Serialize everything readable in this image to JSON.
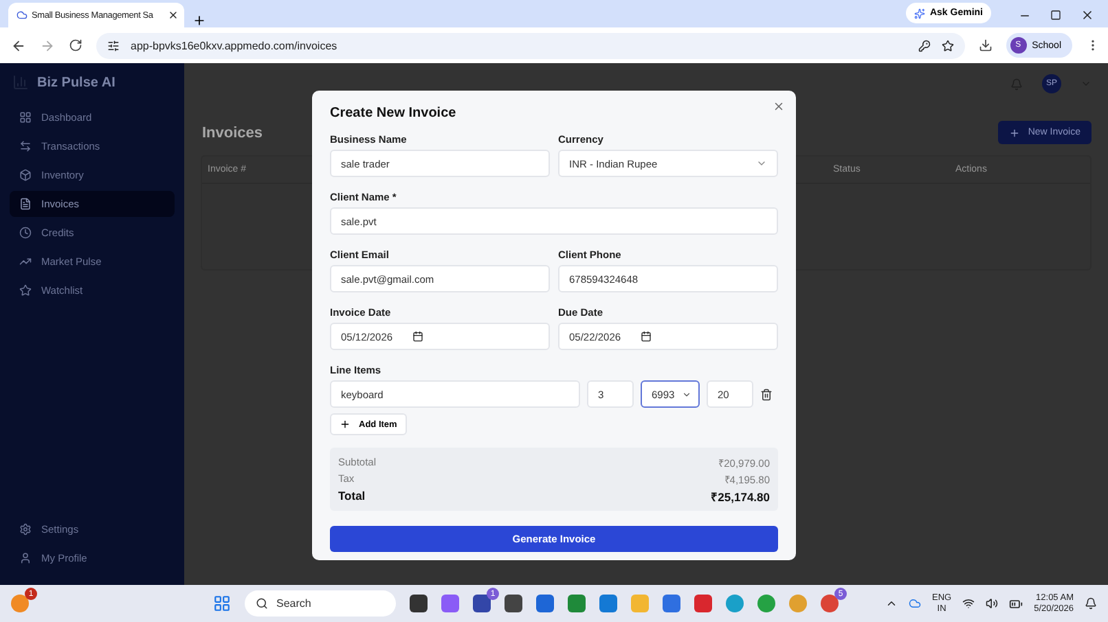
{
  "browser": {
    "tab_title": "Small Business Management Sa",
    "url": "app-bpvks16e0kxv.appmedo.com/invoices",
    "ask_gemini": "Ask Gemini",
    "profile": {
      "initial": "S",
      "label": "School"
    }
  },
  "sidebar": {
    "brand": "Biz Pulse AI",
    "items": [
      {
        "label": "Dashboard",
        "selected": false
      },
      {
        "label": "Transactions",
        "selected": false
      },
      {
        "label": "Inventory",
        "selected": false
      },
      {
        "label": "Invoices",
        "selected": true
      },
      {
        "label": "Credits",
        "selected": false
      },
      {
        "label": "Market Pulse",
        "selected": false
      },
      {
        "label": "Watchlist",
        "selected": false
      }
    ],
    "bottom_items": [
      {
        "label": "Settings",
        "selected": false
      },
      {
        "label": "My Profile",
        "selected": false
      }
    ]
  },
  "header": {
    "avatar": "SP"
  },
  "page": {
    "title": "Invoices",
    "new_button": "New Invoice",
    "table": {
      "columns": [
        "Invoice #",
        "Status",
        "Actions"
      ]
    }
  },
  "modal": {
    "title": "Create New Invoice",
    "business_name": {
      "label": "Business Name",
      "value": "sale trader"
    },
    "currency": {
      "label": "Currency",
      "value": "INR - Indian Rupee"
    },
    "client_name": {
      "label": "Client Name *",
      "value": "sale.pvt"
    },
    "client_email": {
      "label": "Client Email",
      "value": "sale.pvt@gmail.com"
    },
    "client_phone": {
      "label": "Client Phone",
      "value": "678594324648"
    },
    "invoice_date": {
      "label": "Invoice Date",
      "value": "05/12/2026"
    },
    "due_date": {
      "label": "Due Date",
      "value": "05/22/2026"
    },
    "line_items": {
      "label": "Line Items",
      "items": [
        {
          "description": "keyboard",
          "quantity": "3",
          "price": "6993",
          "tax": "20"
        }
      ],
      "add_button": "Add Item"
    },
    "summary": [
      {
        "label": "Subtotal",
        "value": "₹20,979.00",
        "kind": "normal"
      },
      {
        "label": "Tax",
        "value": "₹4,195.80",
        "kind": "normal"
      },
      {
        "label": "Total",
        "value": "₹25,174.80",
        "kind": "total"
      }
    ],
    "submit": "Generate Invoice"
  },
  "taskbar": {
    "notification_badge": "1",
    "search_placeholder": "Search",
    "badges": [
      "1",
      "5"
    ],
    "language": "ENG",
    "region": "IN",
    "time": "12:05 AM",
    "date": "5/20/2026"
  }
}
